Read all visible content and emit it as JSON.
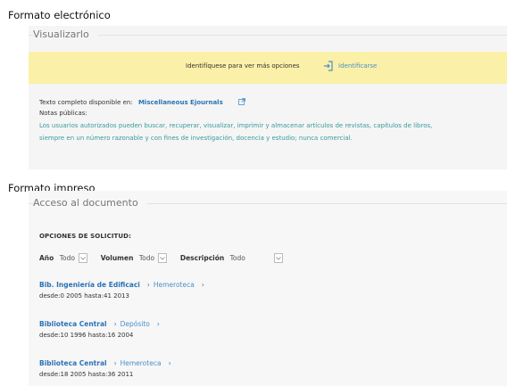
{
  "electronic": {
    "heading": "Formato electrónico",
    "subtitle": "Visualizarlo",
    "banner": {
      "text": "Identifíquese para ver más opciones",
      "link": "Identificarse"
    },
    "fulltext_label": "Texto completo disponible en:",
    "fulltext_source": "Miscellaneous Ejournals",
    "notes_label": "Notas públicas:",
    "notes_line1": "Los usuarios autorizados pueden buscar, recuperar, visualizar, imprimir y almacenar artículos de revistas, capítulos de libros,",
    "notes_line2": "siempre en un número razonable y con fines de investigación, docencia y estudio; nunca comercial."
  },
  "print": {
    "heading": "Formato impreso",
    "subtitle": "Acceso al documento",
    "options_title": "OPCIONES DE SOLICITUD:",
    "filters": {
      "year_label": "Año",
      "year_value": "Todo",
      "volume_label": "Volumen",
      "volume_value": "Todo",
      "desc_label": "Descripción",
      "desc_value": "Todo"
    },
    "holdings": [
      {
        "library": "Bib. Ingeniería de Edificaci",
        "location": "Hemeroteca",
        "range": "desde:0 2005 hasta:41 2013"
      },
      {
        "library": "Biblioteca Central",
        "location": "Depósito",
        "range": "desde:10 1996 hasta:16 2004"
      },
      {
        "library": "Biblioteca Central",
        "location": "Hemeroteca",
        "range": "desde:18 2005 hasta:36 2011"
      }
    ]
  },
  "colors": {
    "banner": "#fbf0a8",
    "link": "#2a73b5",
    "note": "#3a9a9a"
  }
}
